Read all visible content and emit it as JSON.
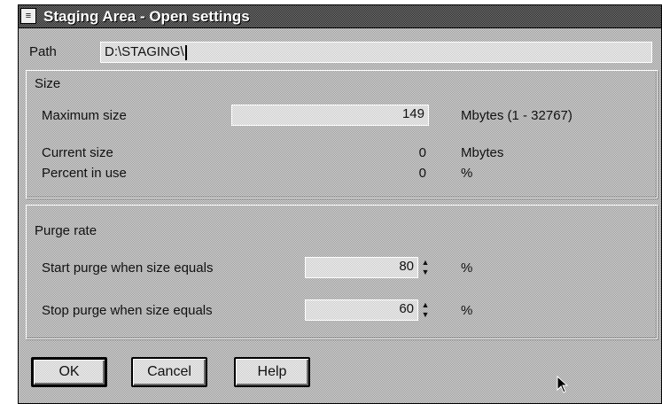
{
  "window": {
    "title": "Staging Area - Open settings",
    "sysmenu_glyph": "≡"
  },
  "path": {
    "label": "Path",
    "value": "D:\\STAGING\\"
  },
  "size_group": {
    "heading": "Size",
    "maximum_size": {
      "label": "Maximum size",
      "value": "149",
      "unit": "Mbytes (1 - 32767)"
    },
    "current_size": {
      "label": "Current size",
      "value": "0",
      "unit": "Mbytes"
    },
    "percent_in_use": {
      "label": "Percent in use",
      "value": "0",
      "unit": "%"
    }
  },
  "purge_group": {
    "heading": "Purge rate",
    "start_purge": {
      "label": "Start purge when size equals",
      "value": "80",
      "unit": "%"
    },
    "stop_purge": {
      "label": "Stop purge when size equals",
      "value": "60",
      "unit": "%"
    }
  },
  "buttons": {
    "ok": "OK",
    "cancel": "Cancel",
    "help": "Help"
  },
  "icons": {
    "spin_up": "▲",
    "spin_down": "▼"
  }
}
